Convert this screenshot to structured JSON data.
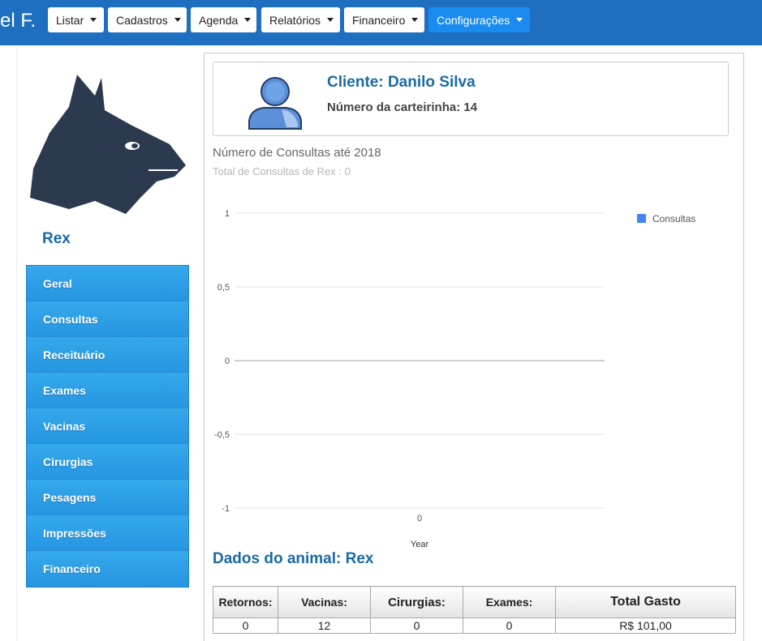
{
  "nav": {
    "brand": "el F.",
    "menus": [
      {
        "label": "Listar"
      },
      {
        "label": "Cadastros"
      },
      {
        "label": "Agenda"
      },
      {
        "label": "Relatórios"
      },
      {
        "label": "Financeiro"
      },
      {
        "label": "Configurações"
      }
    ]
  },
  "pet": {
    "name": "Rex"
  },
  "sidebar": {
    "items": [
      {
        "label": "Geral"
      },
      {
        "label": "Consultas"
      },
      {
        "label": "Receituário"
      },
      {
        "label": "Exames"
      },
      {
        "label": "Vacinas"
      },
      {
        "label": "Cirurgias"
      },
      {
        "label": "Pesagens"
      },
      {
        "label": "Impressões"
      },
      {
        "label": "Financeiro"
      }
    ]
  },
  "client": {
    "name": "Cliente: Danilo Silva",
    "card_number": "Número da carteirinha: 14"
  },
  "chart_data": {
    "type": "line",
    "title": "Número de Consultas até 2018",
    "subtitle": "Total de Consultas de Rex : 0",
    "xlabel": "Year",
    "ylabel": "",
    "x_tick_labels": [
      "0"
    ],
    "y_tick_labels": [
      "1",
      "0,5",
      "0",
      "-0,5",
      "-1"
    ],
    "y_ticks": [
      1,
      0.5,
      0,
      -0.5,
      -1
    ],
    "ylim": [
      -1,
      1
    ],
    "series": [
      {
        "name": "Consultas",
        "values": []
      }
    ],
    "legend_position": "right",
    "colors": {
      "Consultas": "#4285f4"
    }
  },
  "animal": {
    "title": "Dados do animal: Rex",
    "headers": [
      "Retornos:",
      "Vacinas:",
      "Cirurgias:",
      "Exames:",
      "Total Gasto"
    ],
    "values": [
      "0",
      "12",
      "0",
      "0",
      "R$ 101,00"
    ]
  },
  "colors": {
    "navbar": "#1e6fc0",
    "accent_text": "#1a6aa4",
    "sidebar_item": "#2596e0"
  }
}
